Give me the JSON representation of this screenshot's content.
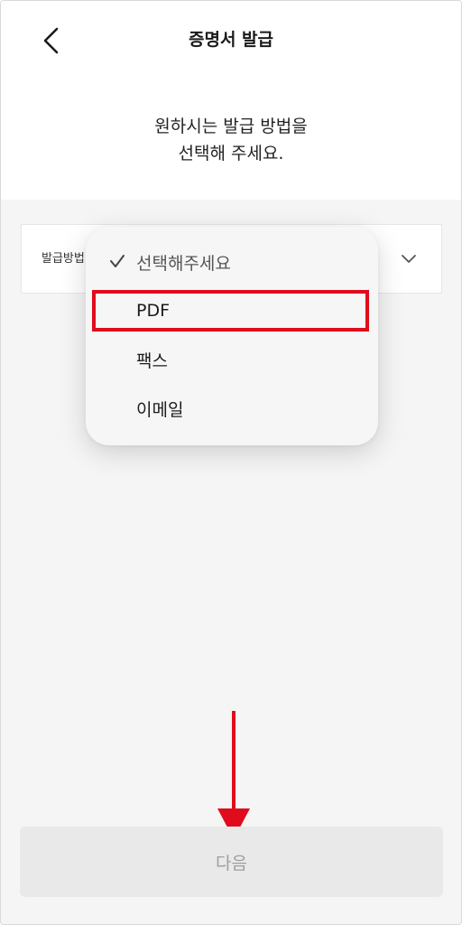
{
  "header": {
    "title": "증명서 발급",
    "back_icon": "chevron-left-icon"
  },
  "instruction": {
    "line1": "원하시는 발급 방법을",
    "line2": "선택해 주세요."
  },
  "select": {
    "label": "발급방법",
    "chevron_icon": "chevron-down-icon"
  },
  "dropdown": {
    "options": [
      {
        "label": "선택해주세요",
        "selected": true
      },
      {
        "label": "PDF",
        "selected": false
      },
      {
        "label": "팩스",
        "selected": false
      },
      {
        "label": "이메일",
        "selected": false
      }
    ]
  },
  "annotation": {
    "highlight_color": "#e00b1c",
    "arrow_color": "#e00b1c"
  },
  "footer": {
    "next_label": "다음"
  },
  "colors": {
    "background": "#f5f5f5",
    "button_disabled": "#e9e9e9",
    "button_text_disabled": "#9e9e9e"
  }
}
